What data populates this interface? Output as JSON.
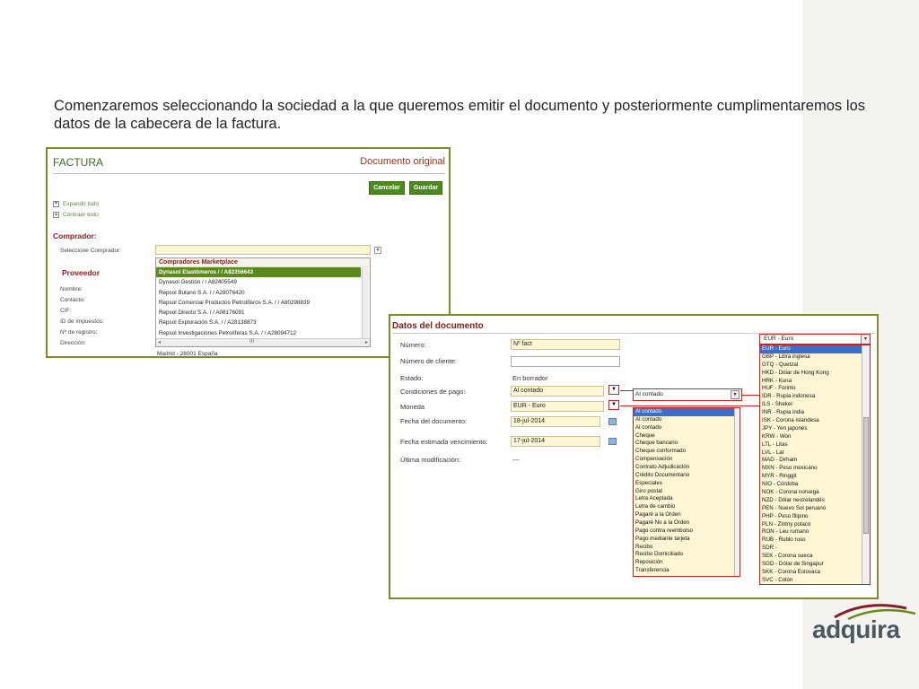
{
  "intro_text": "Comenzaremos seleccionando la sociedad a la que queremos emitir el documento y posteriormente cumplimentaremos los datos de la cabecera de la factura.",
  "factura": {
    "title": "FACTURA",
    "doc_type": "Documento original",
    "cancel_label": "Cancelar",
    "save_label": "Guardar",
    "expand_label": "Expandir todo",
    "collapse_label": "Contraer todo",
    "comprador_title": "Comprador:",
    "select_buyer_label": "Seleccione Comprador:",
    "proveedor_title": "Proveedor",
    "fields": [
      "Nombre:",
      "Contacto:",
      "CIF:",
      "ID de impuestos:",
      "Nº de registro:",
      "Dirección:"
    ],
    "dropdown_header": "Compradores Marketplace",
    "dropdown_items": [
      "Dynasol Elastómeros / / A82356643",
      "Dynasol Gestión / / A82405549",
      "Repsol Butano S.A. / / A28076420",
      "Repsol Comercial Productos Petrolíferos S.A. / / A80298839",
      "Repsol Directo S.A. / / A08176091",
      "Repsol Exploración S.A. / / A28138873",
      "Repsol Investigaciones Petrolíferas S.A. / / A28094712"
    ],
    "selected_index": 0,
    "scroll_glyph": "III",
    "address": "Madrid - 28001 España"
  },
  "datos": {
    "title": "Datos del documento",
    "labels": {
      "numero": "Número:",
      "numero_cliente": "Número de cliente:",
      "estado": "Estado:",
      "condiciones": "Condiciones de pago:",
      "moneda": "Moneda",
      "fecha_doc": "Fecha del documento:",
      "fecha_venc": "Fecha estimada vencimiento:",
      "ultima_mod": "Última modificación:"
    },
    "values": {
      "numero": "Nº fact",
      "numero_cliente": "",
      "estado": "En borrador",
      "condiciones": "Al contado",
      "condiciones_expanded": "Al contado",
      "moneda": "EUR - Euro",
      "fecha_doc": "18-jul-2014",
      "fecha_venc": "17-jul-2014",
      "ultima_mod": "---"
    },
    "payment_options": [
      "Al contado",
      "Al contado",
      "Al contado",
      "Cheque",
      "Cheque bancario",
      "Cheque conformado",
      "Compensación",
      "Contrato Adjudicación",
      "Crédito Documentario",
      "Especiales",
      "Giro postal",
      "Letra Aceptada",
      "Letra de cambio",
      "Pagaré a la Orden",
      "Pagaré No a la Orden",
      "Pago contra reembolso",
      "Pago mediante tarjeta",
      "Recibo",
      "Recibo Domiciliado",
      "Reposición",
      "Transferencia"
    ],
    "currency_selected": "EUR - Euro",
    "currency_options": [
      "EUR - Euro",
      "GBP - Libra inglesa",
      "GTQ - Quetzal",
      "HKD - Dólar de Hong Kong",
      "HRK - Kuna",
      "HUF - Forinto",
      "IDR - Rupia indonesa",
      "ILS - Shekel",
      "INR - Rupia india",
      "ISK - Corona islandesa",
      "JPY - Yen japonés",
      "KRW - Won",
      "LTL - Litas",
      "LVL - Lat",
      "MAD - Dirham",
      "MXN - Peso mexicano",
      "MYR - Ringgit",
      "NIO - Córdoba",
      "NOK - Corona noruega",
      "NZD - Dólar neozelandés",
      "PEN - Nuevo Sol peruano",
      "PHP - Peso filipino",
      "PLN - Zlotny polaco",
      "RON - Leu rumano",
      "RUB - Rublo ruso",
      "SDR -",
      "SEK - Corona sueca",
      "SGD - Dólar de Singapur",
      "SKK - Corona Eslovaca",
      "SVC - Colón"
    ]
  },
  "logo": {
    "text": "adquira"
  }
}
